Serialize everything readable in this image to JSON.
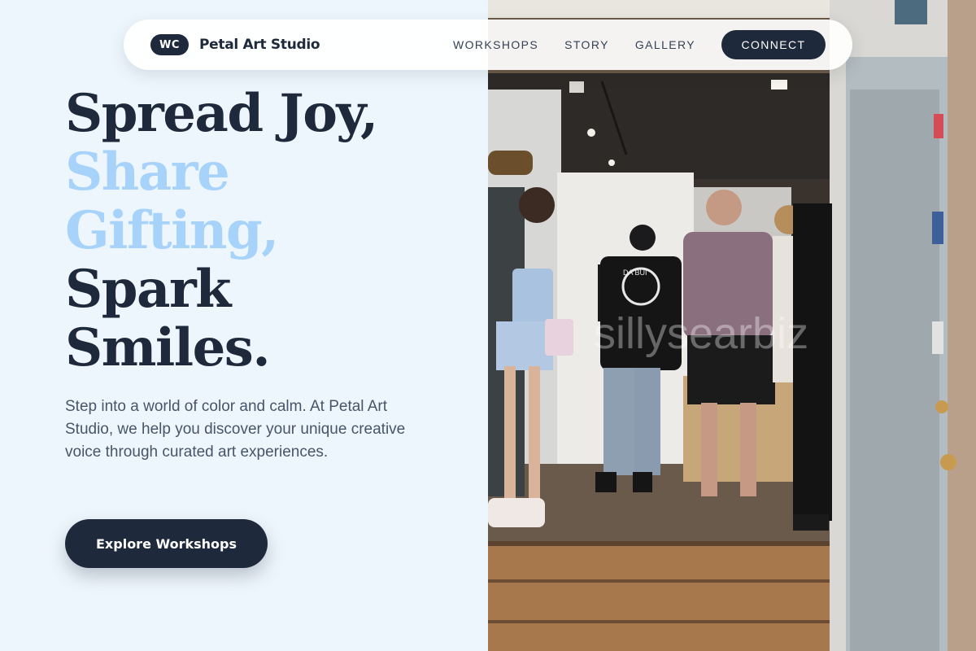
{
  "nav": {
    "logo_badge": "WC",
    "brand": "Petal Art Studio",
    "links": [
      "WORKSHOPS",
      "STORY",
      "GALLERY"
    ],
    "cta_label": "CONNECT"
  },
  "hero": {
    "headline_lines": [
      {
        "text": "Spread Joy,",
        "accent": false
      },
      {
        "text": "Share",
        "accent": true
      },
      {
        "text": "Gifting,",
        "accent": true
      },
      {
        "text": "Spark",
        "accent": false
      },
      {
        "text": "Smiles.",
        "accent": false
      }
    ],
    "description": "Step into a world of color and calm. At Petal Art Studio, we help you discover your unique creative voice through curated art experiences.",
    "button_label": "Explore Workshops"
  },
  "photo": {
    "watermark": "sillysearbiz",
    "shirt_text": "DA BUI"
  },
  "colors": {
    "background": "#eef6fd",
    "primary": "#1e293b",
    "accent": "#a7d3fb",
    "body_text": "#475569"
  }
}
